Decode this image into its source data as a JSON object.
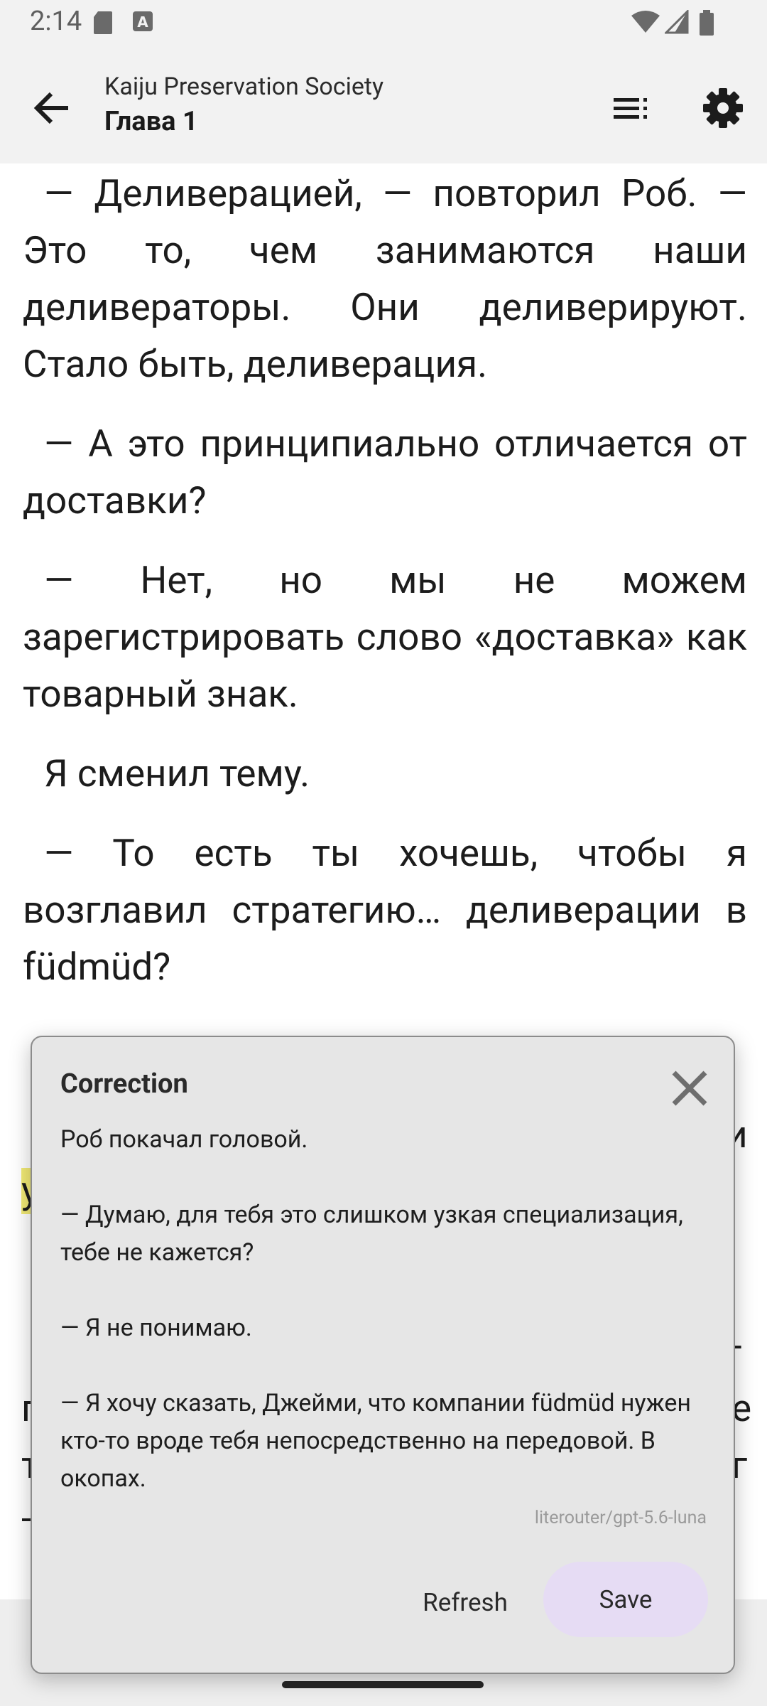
{
  "status_bar": {
    "time": "2:14"
  },
  "app_bar": {
    "book_title": "Kaiju Preservation Society",
    "chapter_title": "Глава 1"
  },
  "reader": {
    "paragraphs": [
      "— Деливерацией, — повторил Роб. — Это то, чем занимаются наши деливераторы. Они деливерируют. Стало быть, деливерация.",
      "— А это принципиально отличается от доставки?",
      "— Нет, но мы не можем зарегистрировать слово «доставка» как товарный знак.",
      "Я сменил тему.",
      "— То есть ты хочешь, чтобы я возглавил стратегию… деливерации в füdmüd?"
    ],
    "edge_fragments": [
      "и",
      "у",
      "-",
      "г",
      "е",
      "т",
      "г",
      "-"
    ]
  },
  "dialog": {
    "title": "Correction",
    "body": [
      "Роб покачал головой.",
      "— Думаю, для тебя это слишком узкая специализация, тебе не кажется?",
      "— Я не понимаю.",
      "— Я хочу сказать, Джейми, что компании füdmüd нужен кто-то вроде тебя непосредственно на передовой. В окопах."
    ],
    "model": "literouter/gpt-5.6-luna",
    "refresh_label": "Refresh",
    "save_label": "Save"
  },
  "colors": {
    "highlight": "#f2ea75",
    "save_button_bg": "#e6dcf4",
    "dialog_bg": "#e6e6e6",
    "bar_bg": "#f2f2f2"
  },
  "icons": [
    "sd-card-icon",
    "font-a-icon",
    "wifi-icon",
    "signal-icon",
    "battery-icon",
    "back-arrow-icon",
    "toc-icon",
    "gear-icon",
    "close-icon"
  ]
}
